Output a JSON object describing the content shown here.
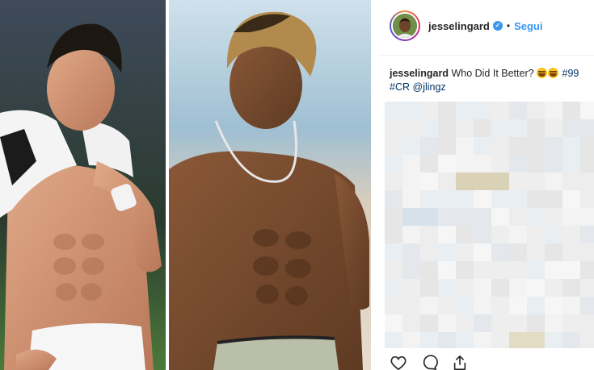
{
  "post": {
    "username": "jesselingard",
    "follow_label": "Segui",
    "separator": "•",
    "verified_icon": "verified-badge-icon",
    "caption": {
      "user": "jesselingard",
      "text": "Who Did It Better?",
      "hashtag_1": "#99",
      "hashtag_2": "#CR",
      "mention": "@jlingz"
    },
    "actions": [
      "heart-icon",
      "comment-icon",
      "share-icon"
    ]
  },
  "colors": {
    "accent_blue": "#3897f0",
    "text": "#262626",
    "hashtag": "#003569",
    "divider": "#efefef"
  }
}
